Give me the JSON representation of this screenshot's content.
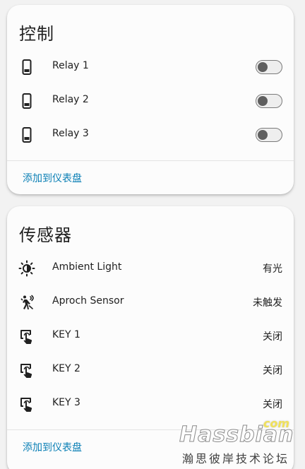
{
  "controls": {
    "title": "控制",
    "items": [
      {
        "label": "Relay 1",
        "state": "off",
        "icon": "phone-icon"
      },
      {
        "label": "Relay 2",
        "state": "off",
        "icon": "phone-icon"
      },
      {
        "label": "Relay 3",
        "state": "off",
        "icon": "phone-icon"
      }
    ],
    "add_to_dashboard": "添加到仪表盘"
  },
  "sensors": {
    "title": "传感器",
    "items": [
      {
        "label": "Ambient Light",
        "value": "有光",
        "icon": "brightness-icon"
      },
      {
        "label": "Aproch Sensor",
        "value": "未触发",
        "icon": "motion-sensor-icon"
      },
      {
        "label": "KEY 1",
        "value": "关闭",
        "icon": "gesture-tap-icon"
      },
      {
        "label": "KEY 2",
        "value": "关闭",
        "icon": "gesture-tap-icon"
      },
      {
        "label": "KEY 3",
        "value": "关闭",
        "icon": "gesture-tap-icon"
      }
    ],
    "add_to_dashboard": "添加到仪表盘"
  },
  "watermark": {
    "brand": "Hassbian",
    "domain": "com",
    "subtitle": "瀚思彼岸技术论坛"
  },
  "colors": {
    "accent": "#0a7fb5",
    "card_bg": "#fcfcfc",
    "page_bg": "#f2f2f2",
    "text": "#212121"
  }
}
